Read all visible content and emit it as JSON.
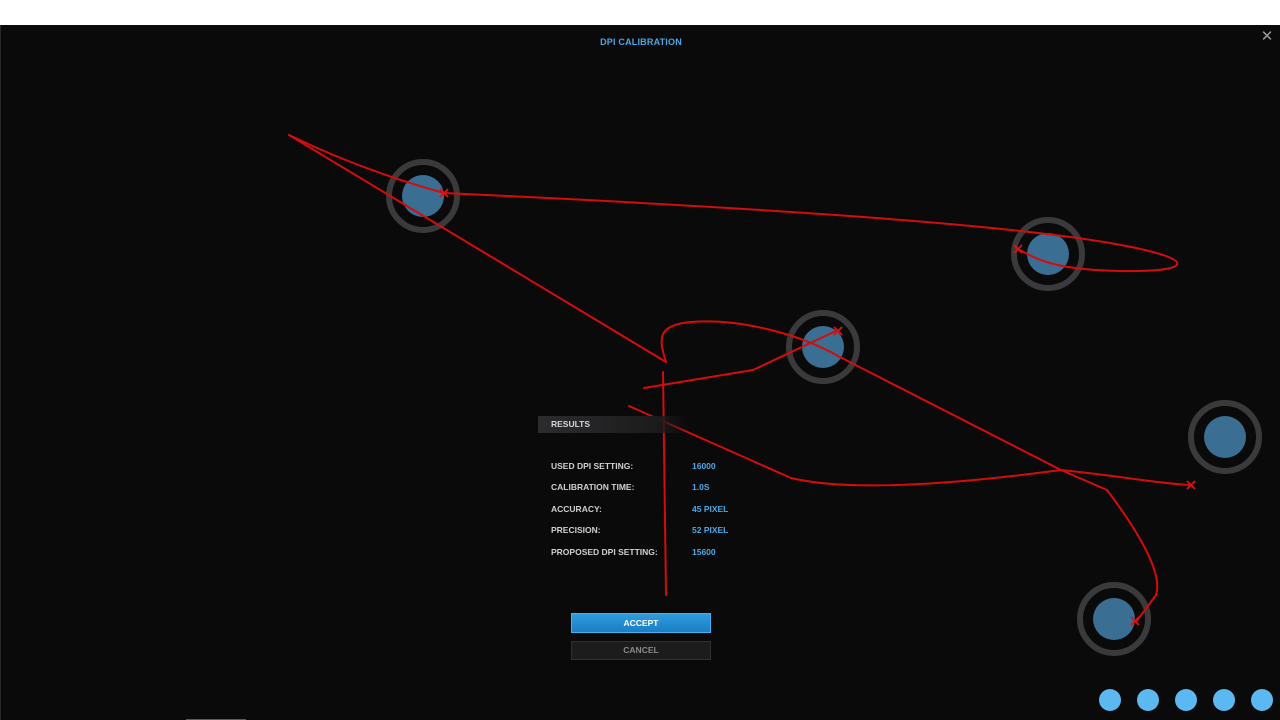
{
  "window": {
    "title": "DPI CALIBRATION",
    "close_symbol": "✕"
  },
  "results": {
    "header": "RESULTS",
    "rows": [
      {
        "label": "USED DPI SETTING:",
        "value": "16000"
      },
      {
        "label": "CALIBRATION TIME:",
        "value": "1.0S"
      },
      {
        "label": "ACCURACY:",
        "value": "45 PIXEL"
      },
      {
        "label": "PRECISION:",
        "value": "52 PIXEL"
      },
      {
        "label": "PROPOSED DPI SETTING:",
        "value": "15600"
      }
    ]
  },
  "buttons": {
    "accept": "ACCEPT",
    "cancel": "CANCEL"
  },
  "colors": {
    "accent": "#4aa8e6",
    "target_fill": "#3b6e93",
    "target_ring": "#3a3a3c",
    "trace": "#d40c0c",
    "dot": "#5bb8f0"
  },
  "pagination": {
    "count": 5
  }
}
